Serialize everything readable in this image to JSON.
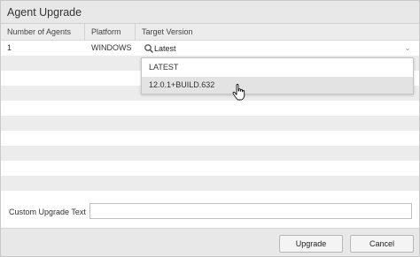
{
  "dialog": {
    "title": "Agent Upgrade"
  },
  "table": {
    "columns": [
      "Number of Agents",
      "Platform",
      "Target Version"
    ],
    "rows": [
      {
        "number_of_agents": "1",
        "platform": "WINDOWS",
        "target_version": "Latest"
      }
    ]
  },
  "version_select": {
    "icon": "search-icon",
    "value": "Latest",
    "options": [
      "LATEST",
      "12.0.1+BUILD.632"
    ],
    "hovered_option": "12.0.1+BUILD.632"
  },
  "custom_upgrade": {
    "label": "Custom Upgrade Text",
    "value": ""
  },
  "buttons": {
    "upgrade": "Upgrade",
    "cancel": "Cancel"
  },
  "colors": {
    "titlebar_bg": "#e8e8e8",
    "header_bg": "#ececec",
    "stripe_bg": "#ececec",
    "option_hover_bg": "#e3e3e3"
  }
}
